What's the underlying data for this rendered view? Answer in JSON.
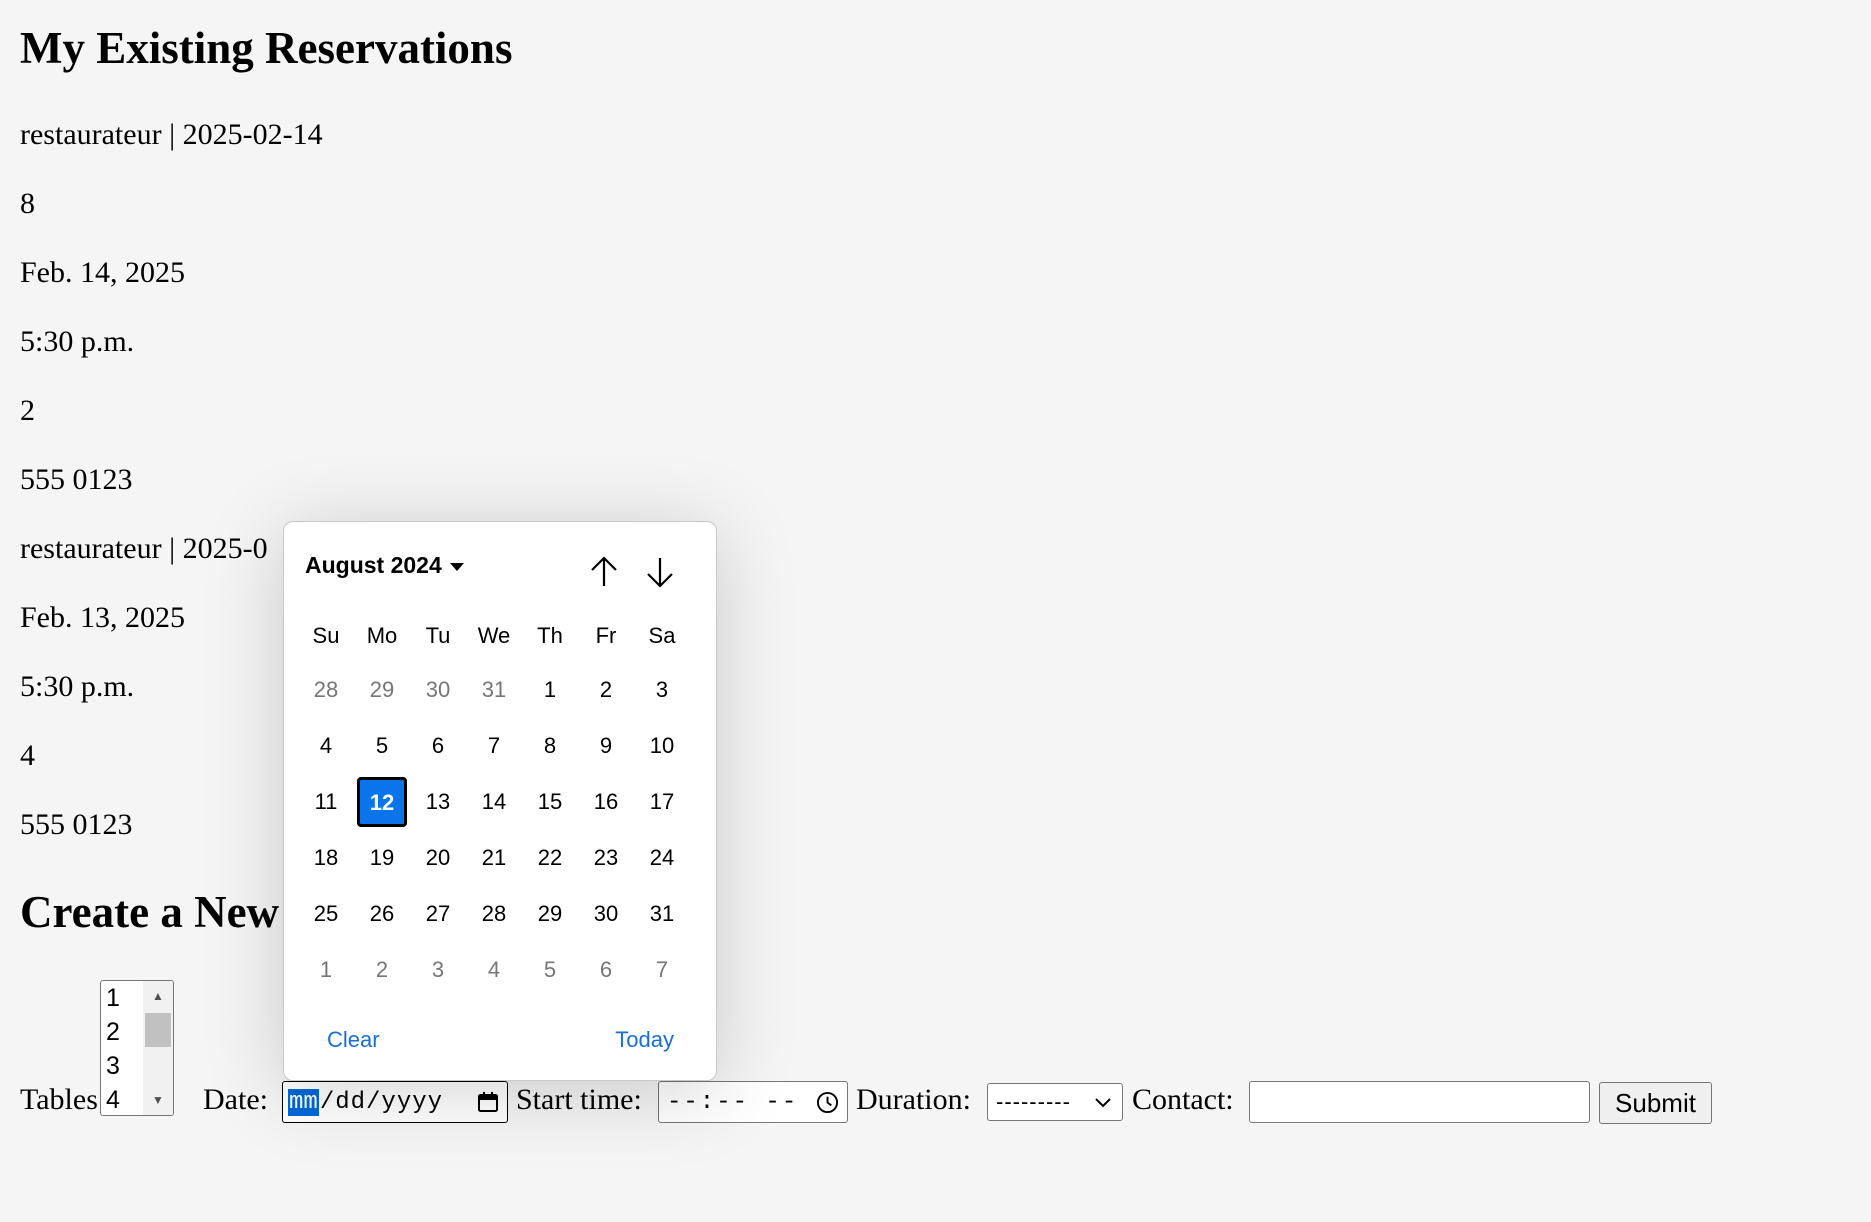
{
  "heading": "My Existing Reservations",
  "reservations": [
    {
      "title": "restaurateur | 2025-02-14",
      "tables": "8",
      "date": "Feb. 14, 2025",
      "time": "5:30 p.m.",
      "duration": "2",
      "contact": "555 0123"
    },
    {
      "title": "restaurateur | 2025-0",
      "date": "Feb. 13, 2025",
      "time": "5:30 p.m.",
      "duration": "4",
      "contact": "555 0123"
    }
  ],
  "create_heading": "Create a New",
  "form": {
    "tables_label": "Tables:",
    "tables_options": [
      "1",
      "2",
      "3",
      "4"
    ],
    "date_label": "Date:",
    "date_active_segment": "mm",
    "date_rest": "/dd/yyyy",
    "start_label": "Start time:",
    "start_value": "--:-- --",
    "duration_label": "Duration:",
    "duration_value": "---------",
    "contact_label": "Contact:",
    "contact_value": "",
    "submit_label": "Submit"
  },
  "calendar": {
    "month_label": "August 2024",
    "weekdays": [
      "Su",
      "Mo",
      "Tu",
      "We",
      "Th",
      "Fr",
      "Sa"
    ],
    "weeks": [
      [
        "28",
        "29",
        "30",
        "31",
        "1",
        "2",
        "3"
      ],
      [
        "4",
        "5",
        "6",
        "7",
        "8",
        "9",
        "10"
      ],
      [
        "11",
        "12",
        "13",
        "14",
        "15",
        "16",
        "17"
      ],
      [
        "18",
        "19",
        "20",
        "21",
        "22",
        "23",
        "24"
      ],
      [
        "25",
        "26",
        "27",
        "28",
        "29",
        "30",
        "31"
      ],
      [
        "1",
        "2",
        "3",
        "4",
        "5",
        "6",
        "7"
      ]
    ],
    "selected_day": "12",
    "clear_label": "Clear",
    "today_label": "Today",
    "colors": {
      "selected_bg": "#0a74ea",
      "link": "#1a6ed8",
      "muted": "#767676"
    },
    "icons": [
      "caret-down-icon",
      "arrow-up-icon",
      "arrow-down-icon"
    ]
  }
}
